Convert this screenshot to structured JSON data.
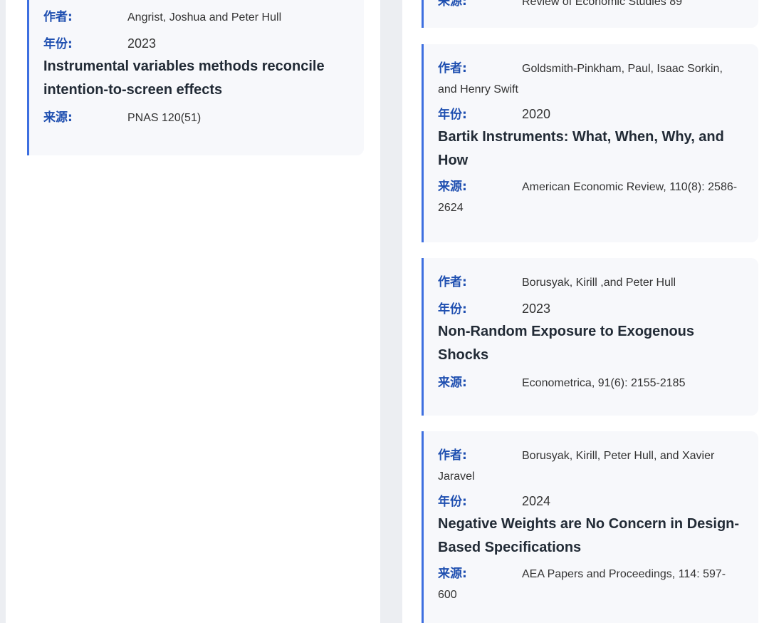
{
  "labels": {
    "author": "作者:",
    "year": "年份:",
    "source": "来源:"
  },
  "left_column": {
    "cards": [
      {
        "author": "Angrist, Joshua and Peter Hull",
        "year": "2023",
        "title": "Instrumental variables methods reconcile intention-to-screen effects",
        "source": "PNAS 120(51)"
      }
    ]
  },
  "right_column": {
    "partial_source": "Review of Economic Studies 89",
    "cards": [
      {
        "author": "Goldsmith-Pinkham, Paul, Isaac Sorkin, and Henry Swift",
        "year": "2020",
        "title": "Bartik Instruments: What, When, Why, and How",
        "source": "American Economic Review, 110(8): 2586-2624"
      },
      {
        "author": "Borusyak, Kirill ,and Peter Hull",
        "year": "2023",
        "title": "Non-Random Exposure to Exogenous Shocks",
        "source": "Econometrica, 91(6): 2155-2185"
      },
      {
        "author": "Borusyak, Kirill, Peter Hull, and Xavier Jaravel",
        "year": "2024",
        "title": "Negative Weights are No Concern in Design-Based Specifications",
        "source": "AEA Papers and Proceedings, 114: 597-600"
      }
    ]
  },
  "colors": {
    "accent": "#3d6fe0",
    "label": "#1f4fb0",
    "card_bg": "#f7f8fb",
    "page_bg": "#eceef2"
  }
}
